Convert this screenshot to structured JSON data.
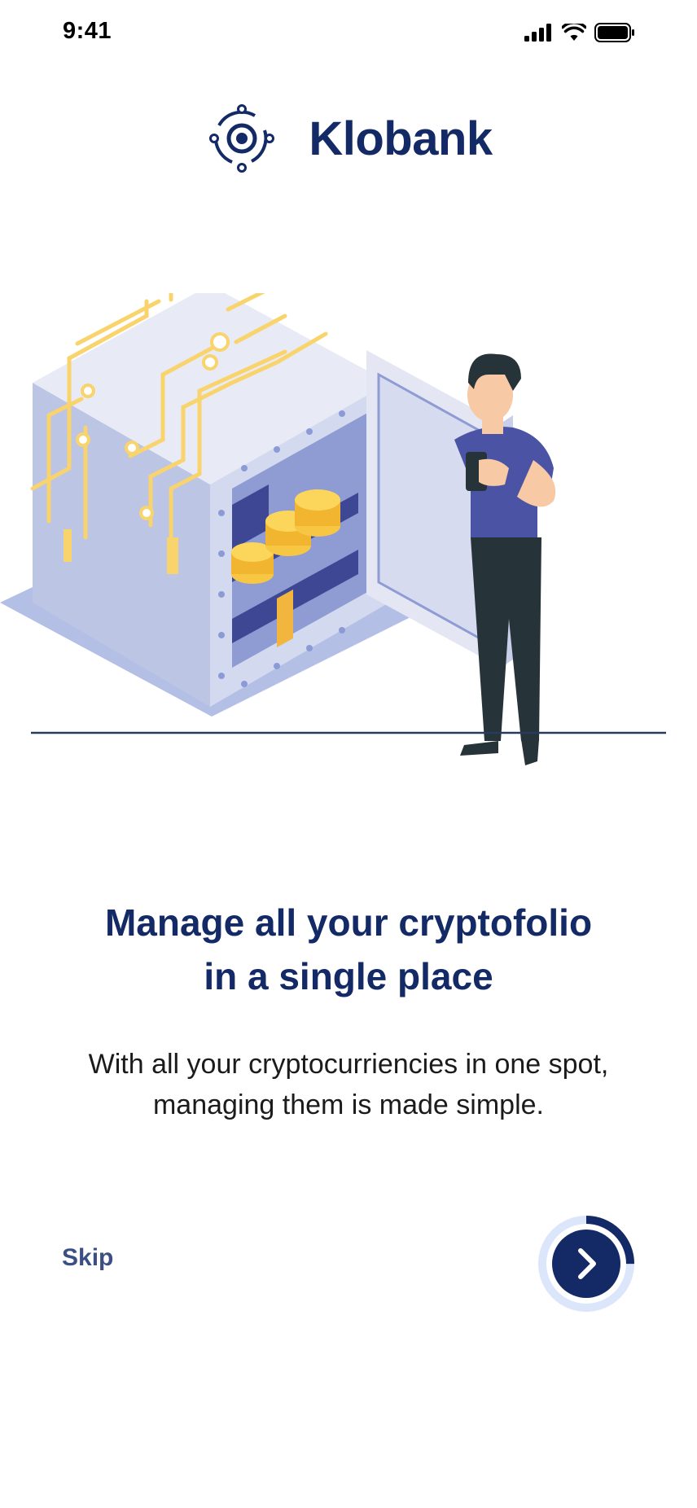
{
  "status_bar": {
    "time": "9:41"
  },
  "brand": {
    "name": "Klobank"
  },
  "onboarding": {
    "headline_line1": "Manage all your cryptofolio",
    "headline_line2": "in a single place",
    "subtext_line1": "With all your cryptocurriencies in one spot,",
    "subtext_line2": "managing them is made simple.",
    "skip_label": "Skip",
    "progress": 0.25
  },
  "colors": {
    "primary": "#132a66",
    "accent_yellow": "#f9d36b",
    "vault_light": "#c9cfe8",
    "progress_track": "#dce6fb"
  },
  "icons": [
    "signal-icon",
    "wifi-icon",
    "battery-icon",
    "klobank-logo-icon",
    "chevron-right-icon"
  ]
}
